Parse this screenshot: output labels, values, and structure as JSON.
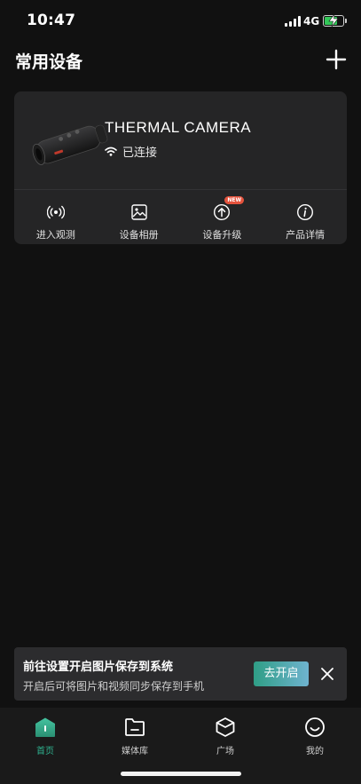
{
  "status_bar": {
    "time": "10:47",
    "network": "4G",
    "battery_level": 0.62
  },
  "header": {
    "title": "常用设备",
    "add_icon": "plus-icon"
  },
  "device_card": {
    "name": "THERMAL CAMERA",
    "status": "已连接",
    "status_icon": "wifi-icon",
    "actions": [
      {
        "label": "进入观测",
        "icon": "radio-waves-icon"
      },
      {
        "label": "设备相册",
        "icon": "image-icon"
      },
      {
        "label": "设备升级",
        "icon": "upload-circle-icon",
        "badge": "NEW"
      },
      {
        "label": "产品详情",
        "icon": "info-circle-icon"
      }
    ]
  },
  "banner": {
    "title": "前往设置开启图片保存到系统",
    "subtitle": "开启后可将图片和视频同步保存到手机",
    "button_label": "去开启"
  },
  "tab_bar": {
    "active_index": 0,
    "tabs": [
      {
        "label": "首页",
        "icon": "home-icon"
      },
      {
        "label": "媒体库",
        "icon": "folder-icon"
      },
      {
        "label": "广场",
        "icon": "box-icon"
      },
      {
        "label": "我的",
        "icon": "smile-icon"
      }
    ]
  },
  "colors": {
    "background": "#111111",
    "card": "#252526",
    "accent": "#2fb390",
    "badge": "#e5533d"
  }
}
